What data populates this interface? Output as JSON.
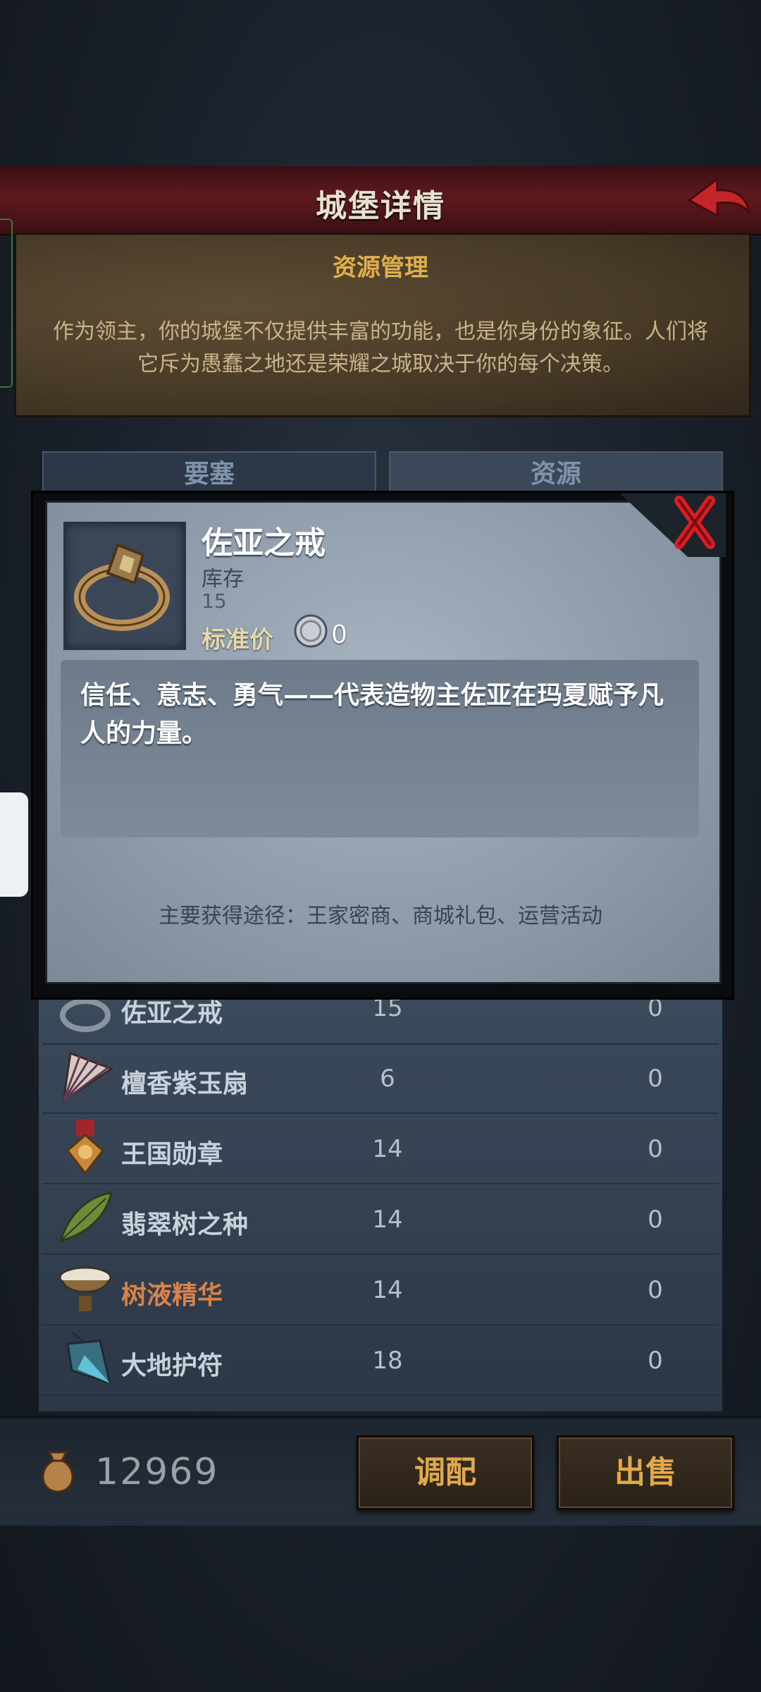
{
  "header": {
    "title": "城堡详情"
  },
  "info": {
    "title": "资源管理",
    "text_line1": "作为领主，你的城堡不仅提供丰富的功能，也是你身份的象征。人们将",
    "text_line2": "它斥为愚蠢之地还是荣耀之城取决于你的每个决策。"
  },
  "tabs": [
    {
      "label": "要塞"
    },
    {
      "label": "资源"
    }
  ],
  "list": {
    "rows": [
      {
        "name": "佐亚之戒",
        "stock": "15",
        "sold": "0",
        "icon": "ring-icon"
      },
      {
        "name": "檀香紫玉扇",
        "stock": "6",
        "sold": "0",
        "icon": "fan-icon"
      },
      {
        "name": "王国勋章",
        "stock": "14",
        "sold": "0",
        "icon": "medal-icon"
      },
      {
        "name": "翡翠树之种",
        "stock": "14",
        "sold": "0",
        "icon": "leaf-icon"
      },
      {
        "name": "树液精华",
        "stock": "14",
        "sold": "0",
        "icon": "bowl-icon"
      },
      {
        "name": "大地护符",
        "stock": "18",
        "sold": "0",
        "icon": "amulet-icon"
      }
    ]
  },
  "bottom": {
    "gold": "12969",
    "blend_label": "调配",
    "sell_label": "出售"
  },
  "modal": {
    "item_name": "佐亚之戒",
    "stock_label": "库存",
    "stock_value": "15",
    "price_label": "标准价",
    "price_value": "0",
    "description": "信任、意志、勇气——代表造物主佐亚在玛夏赋予凡人的力量。",
    "source": "主要获得途径：王家密商、商城礼包、运营活动"
  },
  "colors": {
    "banner": "#5e1a1e",
    "accent_gold": "#e2a947",
    "highlight_row_name": "#d9834a"
  }
}
